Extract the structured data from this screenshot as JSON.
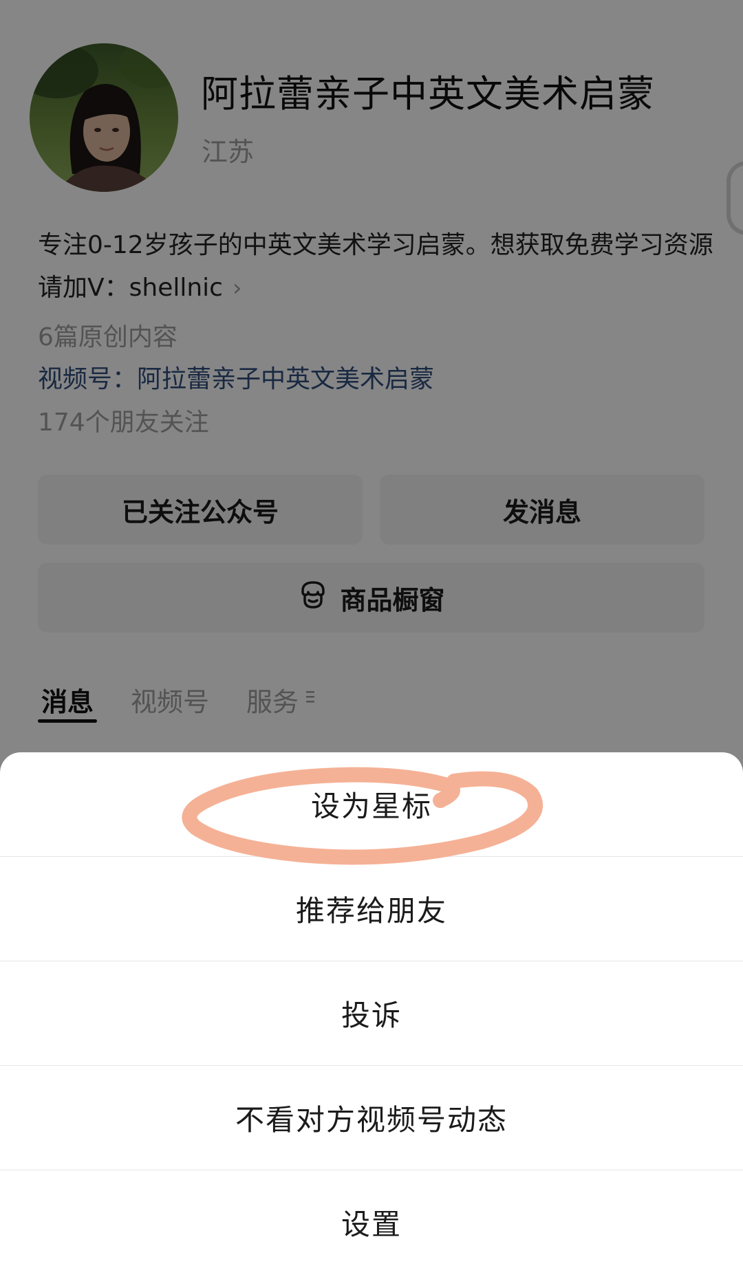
{
  "profile": {
    "name": "阿拉蕾亲子中英文美术启蒙",
    "region": "江苏",
    "bio": "专注0-12岁孩子的中英文美术学习启蒙。想获取免费学习资源请加V：shellnic",
    "bio_chevron": "›",
    "articles_count": "6篇原创内容",
    "channels_line": "视频号：阿拉蕾亲子中英文美术启蒙",
    "followers_line": "174个朋友关注"
  },
  "buttons": {
    "followed": "已关注公众号",
    "message": "发消息",
    "shop": "商品橱窗"
  },
  "tabs": [
    {
      "label": "消息",
      "selected": true
    },
    {
      "label": "视频号",
      "selected": false
    },
    {
      "label": "服务",
      "selected": false
    }
  ],
  "action_sheet": {
    "items": [
      {
        "label": "设为星标",
        "highlighted": true
      },
      {
        "label": "推荐给朋友"
      },
      {
        "label": "投诉"
      },
      {
        "label": "不看对方视频号动态"
      },
      {
        "label": "设置"
      }
    ]
  },
  "colors": {
    "annotation_highlight": "#f4a98a",
    "channels_link": "#2f4d7a",
    "overlay": "rgba(0,0,0,0.46)"
  }
}
